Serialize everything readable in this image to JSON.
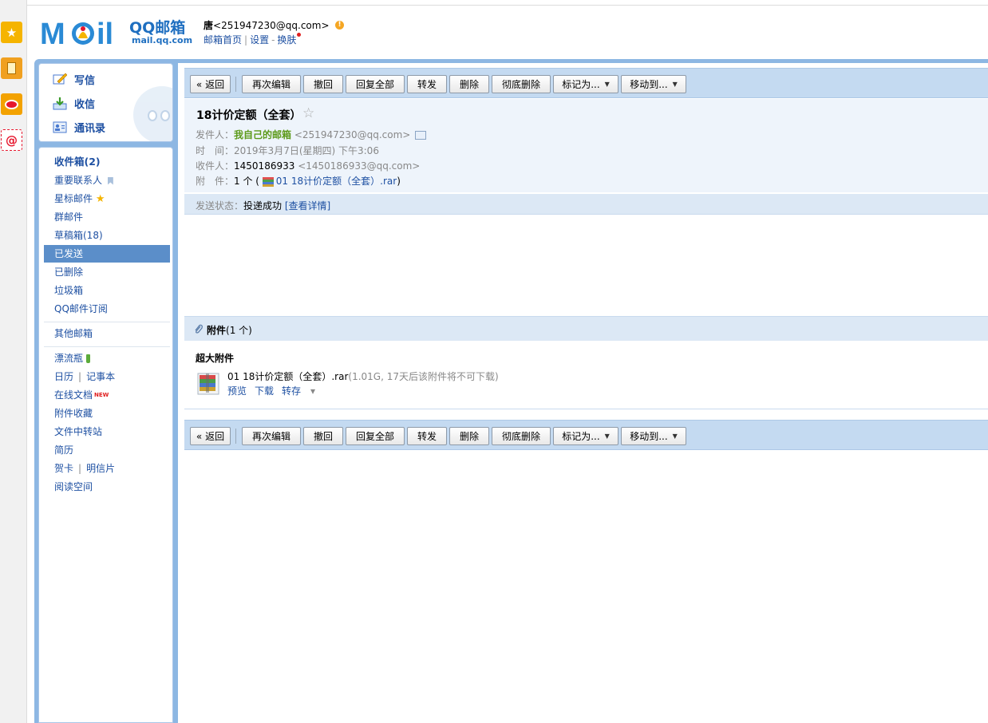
{
  "app_icons": [
    {
      "name": "favorites-star-icon",
      "color": "#f5b400"
    },
    {
      "name": "notebook-icon",
      "color": "#e08a00"
    },
    {
      "name": "weibo-icon",
      "color": "#e6162d"
    },
    {
      "name": "mail-at-icon",
      "color": "#e6162d"
    }
  ],
  "logo": {
    "brand": "QQ邮箱",
    "url": "mail.qq.com",
    "mark": "M  il"
  },
  "user": {
    "name": "唐",
    "email": "<251947230@qq.com>",
    "notice": "!"
  },
  "toplinks": {
    "home": "邮箱首页",
    "settings": "设置",
    "skin": "换肤"
  },
  "sidebar_top": {
    "compose": "写信",
    "inbox": "收信",
    "contacts": "通讯录"
  },
  "folders": {
    "inbox": "收件箱(2)",
    "important": "重要联系人",
    "starred": "星标邮件",
    "group": "群邮件",
    "drafts": "草稿箱(18)",
    "sent": "已发送",
    "deleted": "已删除",
    "spam": "垃圾箱",
    "subscriptions": "QQ邮件订阅",
    "other_mailboxes": "其他邮箱",
    "bottle": "漂流瓶",
    "calendar": "日历",
    "notes": "记事本",
    "docs": "在线文档",
    "new_tag": "NEW",
    "attachment_fav": "附件收藏",
    "file_transfer": "文件中转站",
    "resume": "简历",
    "cards": "贺卡",
    "postcards": "明信片",
    "reading": "阅读空间"
  },
  "toolbar": {
    "back": "« 返回",
    "reedit": "再次编辑",
    "recall": "撤回",
    "reply_all": "回复全部",
    "forward": "转发",
    "delete": "删除",
    "delete_perm": "彻底删除",
    "mark_as": "标记为...",
    "move_to": "移动到...",
    "dropdown_arrow": "▼"
  },
  "mail": {
    "subject": "18计价定额（全套）",
    "star": "☆",
    "from_label": "发件人：",
    "from_name": "我自己的邮箱",
    "from_email": "<251947230@qq.com>",
    "time_label": "时　间：",
    "time_value": "2019年3月7日(星期四) 下午3:06",
    "to_label": "收件人：",
    "to_name": "1450186933",
    "to_email": "<1450186933@qq.com>",
    "att_label": "附　件：",
    "att_count": "1 个 (",
    "att_file": "01 18计价定额（全套）.rar",
    "att_close": ")",
    "status_label": "发送状态：",
    "status_value": "投递成功",
    "status_link": "[查看详情]"
  },
  "attachments": {
    "header": "附件",
    "header_count": "(1 个)",
    "section": "超大附件",
    "file_name": "01 18计价定额（全套）.rar",
    "file_meta": "(1.01G, 17天后该附件将不可下载)",
    "preview": "预览",
    "download": "下载",
    "save_to": "转存",
    "save_arrow": "▾"
  },
  "colors": {
    "accent": "#8db7e3",
    "link": "#1e50a2",
    "selected": "#5b8ec9",
    "green": "#5c9a1a"
  }
}
